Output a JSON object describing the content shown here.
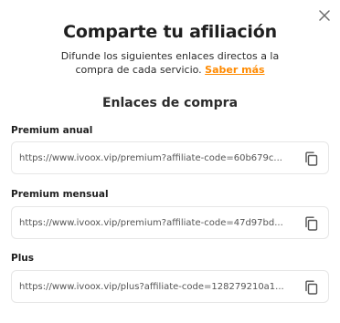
{
  "dialog": {
    "title": "Comparte tu afiliación",
    "description": "Difunde los siguientes enlaces directos a la compra de cada servicio. ",
    "learn_more_label": "Saber más",
    "section_title": "Enlaces de compra",
    "close_icon": "close-icon",
    "accent_color": "#ff8a00"
  },
  "links": [
    {
      "label": "Premium anual",
      "url": "https://www.ivoox.vip/premium?affiliate-code=60b679c...",
      "copy_icon": "copy-icon"
    },
    {
      "label": "Premium mensual",
      "url": "https://www.ivoox.vip/premium?affiliate-code=47d97bd...",
      "copy_icon": "copy-icon"
    },
    {
      "label": "Plus",
      "url": "https://www.ivoox.vip/plus?affiliate-code=128279210a1...",
      "copy_icon": "copy-icon"
    }
  ]
}
